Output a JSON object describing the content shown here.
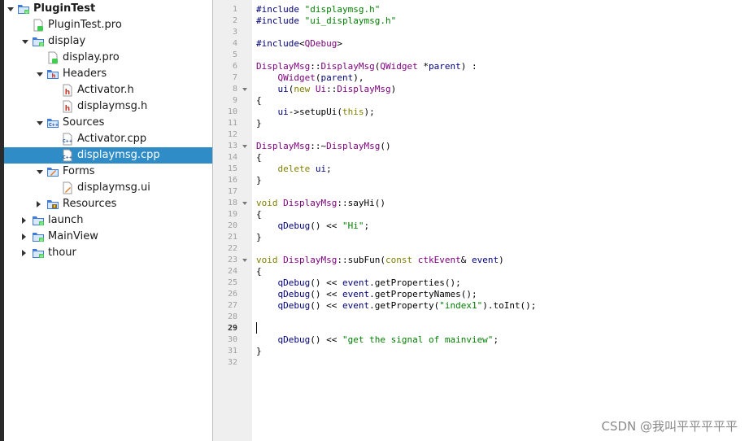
{
  "tree": {
    "items": [
      {
        "label": "PluginTest",
        "icon": "project-folder-icon",
        "arrow": "down",
        "depth": 0,
        "bold": true
      },
      {
        "label": "PluginTest.pro",
        "icon": "pro-file-icon",
        "arrow": "",
        "depth": 1
      },
      {
        "label": "display",
        "icon": "project-folder-icon",
        "arrow": "down",
        "depth": 1
      },
      {
        "label": "display.pro",
        "icon": "pro-file-icon",
        "arrow": "",
        "depth": 2
      },
      {
        "label": "Headers",
        "icon": "headers-folder-icon",
        "arrow": "down",
        "depth": 2
      },
      {
        "label": "Activator.h",
        "icon": "header-file-icon",
        "arrow": "",
        "depth": 3
      },
      {
        "label": "displaymsg.h",
        "icon": "header-file-icon",
        "arrow": "",
        "depth": 3
      },
      {
        "label": "Sources",
        "icon": "sources-folder-icon",
        "arrow": "down",
        "depth": 2
      },
      {
        "label": "Activator.cpp",
        "icon": "cpp-file-icon",
        "arrow": "",
        "depth": 3
      },
      {
        "label": "displaymsg.cpp",
        "icon": "cpp-file-icon",
        "arrow": "",
        "depth": 3,
        "selected": true
      },
      {
        "label": "Forms",
        "icon": "forms-folder-icon",
        "arrow": "down",
        "depth": 2
      },
      {
        "label": "displaymsg.ui",
        "icon": "ui-file-icon",
        "arrow": "",
        "depth": 3
      },
      {
        "label": "Resources",
        "icon": "resources-folder-icon",
        "arrow": "right",
        "depth": 2
      },
      {
        "label": "launch",
        "icon": "project-folder-icon",
        "arrow": "right",
        "depth": 1
      },
      {
        "label": "MainView",
        "icon": "project-folder-icon",
        "arrow": "right",
        "depth": 1
      },
      {
        "label": "thour",
        "icon": "project-folder-icon",
        "arrow": "right",
        "depth": 1
      }
    ]
  },
  "editor": {
    "current_line": 29,
    "folds": [
      8,
      13,
      18,
      23
    ],
    "lines": [
      "#include \"displaymsg.h\"",
      "#include \"ui_displaymsg.h\"",
      "",
      "#include<QDebug>",
      "",
      "DisplayMsg::DisplayMsg(QWidget *parent) :",
      "    QWidget(parent),",
      "    ui(new Ui::DisplayMsg)",
      "{",
      "    ui->setupUi(this);",
      "}",
      "",
      "DisplayMsg::~DisplayMsg()",
      "{",
      "    delete ui;",
      "}",
      "",
      "void DisplayMsg::sayHi()",
      "{",
      "    qDebug() << \"Hi\";",
      "}",
      "",
      "void DisplayMsg::subFun(const ctkEvent& event)",
      "{",
      "    qDebug() << event.getProperties();",
      "    qDebug() << event.getPropertyNames();",
      "    qDebug() << event.getProperty(\"index1\").toInt();",
      "",
      "",
      "    qDebug() << \"get the signal of mainview\";",
      "}",
      ""
    ]
  },
  "watermark": "CSDN @我叫平平平平平"
}
